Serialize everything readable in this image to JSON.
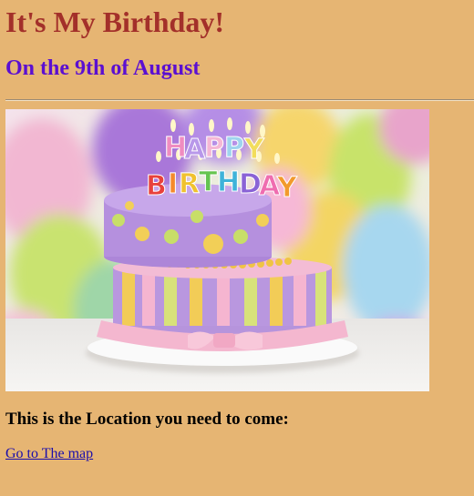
{
  "page": {
    "title": "It's My Birthday!",
    "subtitle": "On the 9th of August",
    "location_text": "This is the Location you need to come:",
    "map_link_text": "Go to The map"
  },
  "image": {
    "subject": "birthday-cake-photo",
    "cake_topper_letters": "HAPPY BIRTHDAY"
  },
  "colors": {
    "background": "#e6b573",
    "title": "#a3302a",
    "subtitle": "#5b0fd1",
    "link": "#1a0dab"
  }
}
